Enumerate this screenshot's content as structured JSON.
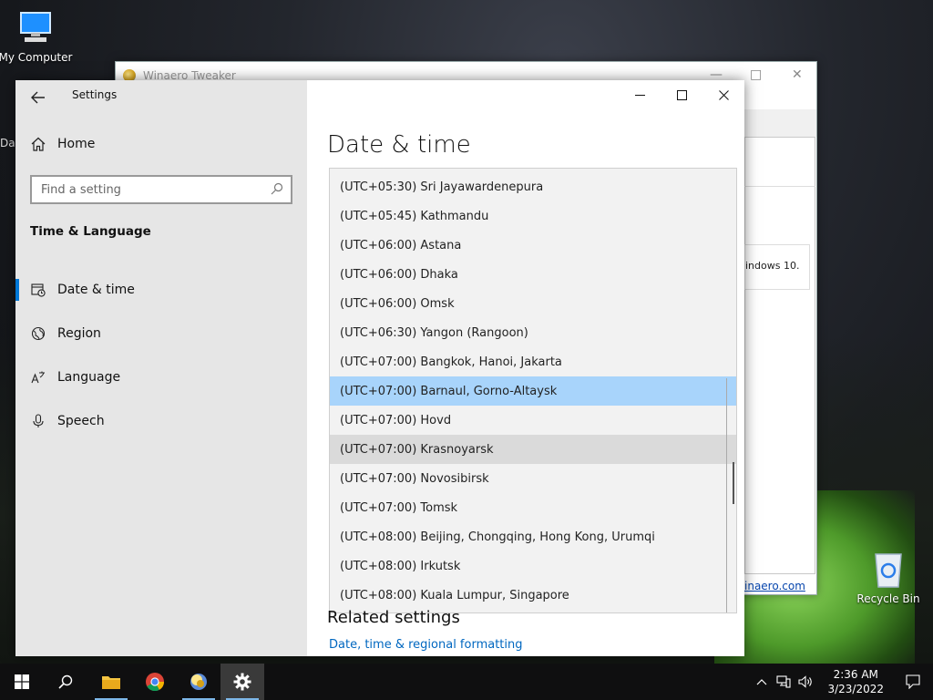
{
  "desktop": {
    "icons": [
      {
        "label": "My Computer"
      },
      {
        "label": "Recycle Bin"
      }
    ],
    "edge_letters": "Da"
  },
  "winaero": {
    "title": "Winaero Tweaker",
    "partial_text": "indows 10.",
    "link": "inaero.com"
  },
  "settings": {
    "app_title": "Settings",
    "home_label": "Home",
    "search_placeholder": "Find a setting",
    "section_title": "Time & Language",
    "nav": [
      {
        "label": "Date & time",
        "icon": "calendar-clock-icon",
        "active": true
      },
      {
        "label": "Region",
        "icon": "globe-icon"
      },
      {
        "label": "Language",
        "icon": "language-icon"
      },
      {
        "label": "Speech",
        "icon": "microphone-icon"
      }
    ],
    "page_title": "Date & time",
    "timezones": [
      "(UTC+05:30) Sri Jayawardenepura",
      "(UTC+05:45) Kathmandu",
      "(UTC+06:00) Astana",
      "(UTC+06:00) Dhaka",
      "(UTC+06:00) Omsk",
      "(UTC+06:30) Yangon (Rangoon)",
      "(UTC+07:00) Bangkok, Hanoi, Jakarta",
      "(UTC+07:00) Barnaul, Gorno-Altaysk",
      "(UTC+07:00) Hovd",
      "(UTC+07:00) Krasnoyarsk",
      "(UTC+07:00) Novosibirsk",
      "(UTC+07:00) Tomsk",
      "(UTC+08:00) Beijing, Chongqing, Hong Kong, Urumqi",
      "(UTC+08:00) Irkutsk",
      "(UTC+08:00) Kuala Lumpur, Singapore"
    ],
    "selected_timezone": "(UTC+07:00) Barnaul, Gorno-Altaysk",
    "hover_timezone": "(UTC+07:00) Krasnoyarsk",
    "related_title": "Related settings",
    "related_link": "Date, time & regional formatting"
  },
  "taskbar": {
    "time": "2:36 AM",
    "date": "3/23/2022",
    "accent": "#0078d7"
  }
}
